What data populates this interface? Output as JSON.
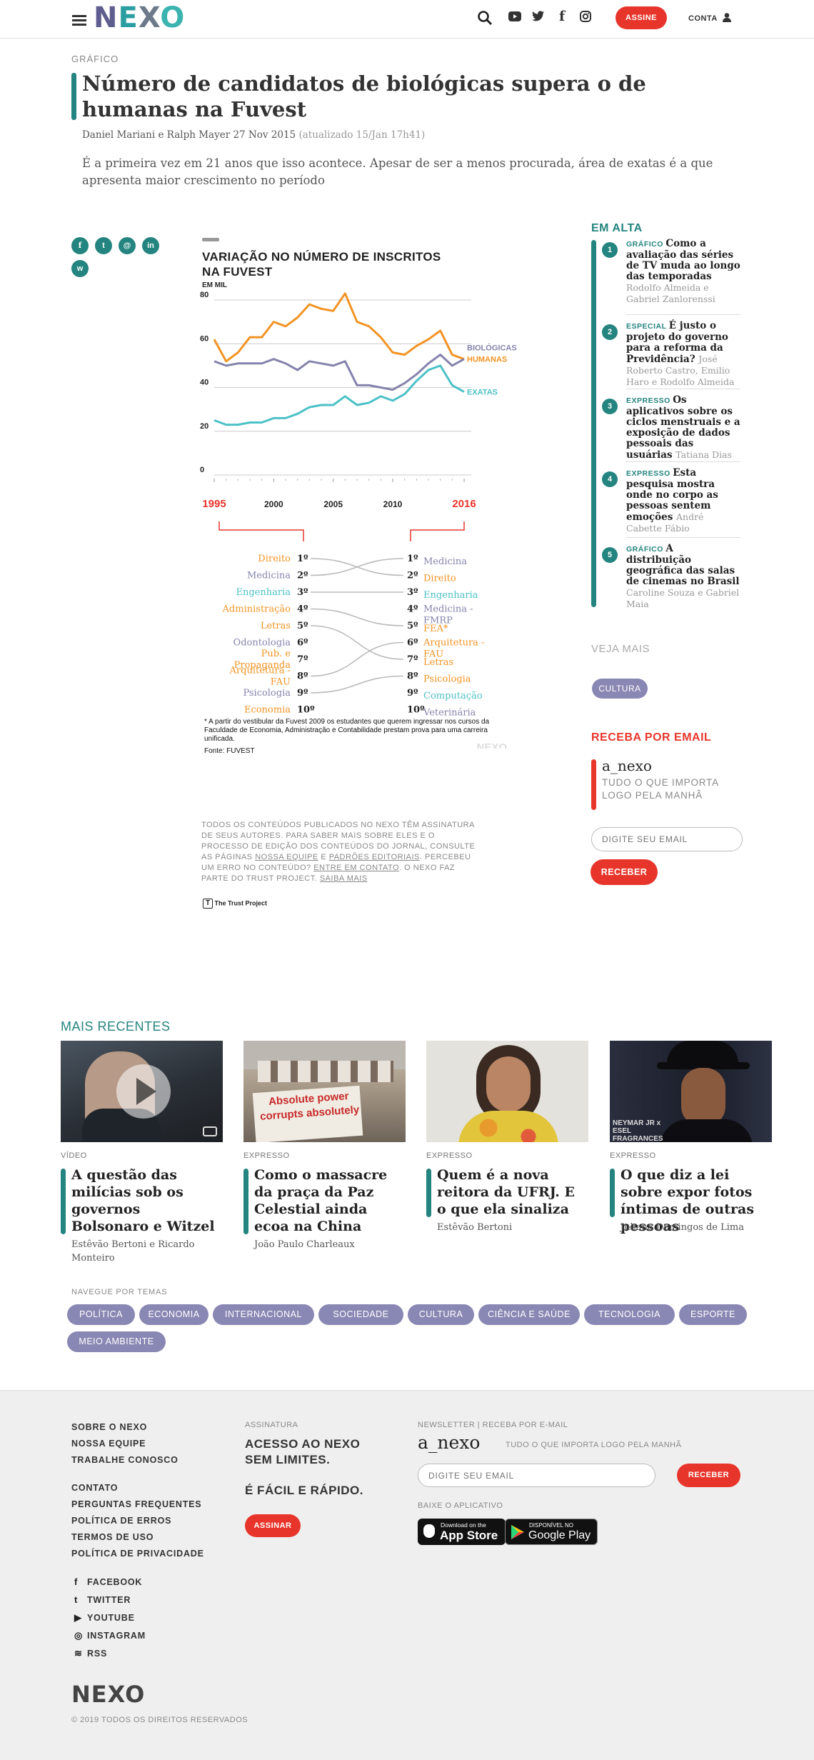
{
  "header": {
    "logo": "NEXO",
    "subscribe_label": "ASSINE",
    "account_label": "CONTA",
    "icons": [
      "menu-icon",
      "search-icon",
      "youtube-icon",
      "twitter-icon",
      "facebook-icon",
      "instagram-icon",
      "user-icon"
    ]
  },
  "article": {
    "kicker": "GRÁFICO",
    "title": "Número de candidatos de biológicas supera o de humanas na Fuvest",
    "byline": "Daniel Mariani e Ralph Mayer 27 Nov 2015",
    "updated": "(atualizado 15/Jan 17h41)",
    "lead": "É a primeira vez em 21 anos que isso acontece. Apesar de ser a menos procurada, área de exatas é a que apresenta maior crescimento no período",
    "share": [
      "f",
      "t",
      "@",
      "in",
      "w"
    ]
  },
  "chart_data": {
    "type": "line",
    "title": "VARIAÇÃO NO NÚMERO DE INSCRITOS NA FUVEST",
    "ylabel": "EM MIL",
    "ylim": [
      0,
      80
    ],
    "yticks": [
      0,
      20,
      40,
      60,
      80
    ],
    "x": [
      1995,
      1996,
      1997,
      1998,
      1999,
      2000,
      2001,
      2002,
      2003,
      2004,
      2005,
      2006,
      2007,
      2008,
      2009,
      2010,
      2011,
      2012,
      2013,
      2014,
      2015,
      2016
    ],
    "xticks": [
      "1995",
      "2000",
      "2005",
      "2010",
      "2016"
    ],
    "series": [
      {
        "name": "HUMANAS",
        "color": "#f39323",
        "values": [
          62,
          52,
          56,
          63,
          63,
          70,
          68,
          72,
          78,
          76,
          75,
          83,
          70,
          68,
          63,
          56,
          55,
          59,
          62,
          66,
          55,
          53
        ]
      },
      {
        "name": "BIOLÓGICAS",
        "color": "#8583ad",
        "values": [
          52,
          50,
          51,
          51,
          51,
          53,
          51,
          48,
          52,
          51,
          50,
          52,
          41,
          41,
          40,
          39,
          42,
          46,
          51,
          55,
          50,
          53
        ]
      },
      {
        "name": "EXATAS",
        "color": "#4cc1c6",
        "values": [
          25,
          23,
          23,
          24,
          24,
          26,
          26,
          28,
          31,
          32,
          32,
          36,
          32,
          33,
          36,
          34,
          37,
          43,
          48,
          50,
          41,
          38
        ]
      }
    ],
    "ranking": {
      "year_left": "1995",
      "year_right": "2016",
      "positions": [
        "1º",
        "2º",
        "3º",
        "4º",
        "5º",
        "6º",
        "7º",
        "8º",
        "9º",
        "10º"
      ],
      "left": [
        {
          "label": "Direito",
          "color": "#f39323"
        },
        {
          "label": "Medicina",
          "color": "#8583ad"
        },
        {
          "label": "Engenharia",
          "color": "#4cc1c6"
        },
        {
          "label": "Administração",
          "color": "#f39323"
        },
        {
          "label": "Letras",
          "color": "#f39323"
        },
        {
          "label": "Odontologia",
          "color": "#8583ad"
        },
        {
          "label": "Pub. e Propaganda",
          "color": "#f39323"
        },
        {
          "label": "Arquitetura - FAU",
          "color": "#f39323"
        },
        {
          "label": "Psicologia",
          "color": "#8583ad"
        },
        {
          "label": "Economia",
          "color": "#f39323"
        }
      ],
      "right": [
        {
          "label": "Medicina",
          "color": "#8583ad"
        },
        {
          "label": "Direito",
          "color": "#f39323"
        },
        {
          "label": "Engenharia",
          "color": "#4cc1c6"
        },
        {
          "label": "Medicina - FMRP",
          "color": "#8583ad"
        },
        {
          "label": "FEA*",
          "color": "#f39323"
        },
        {
          "label": "Arquitetura - FAU",
          "color": "#f39323"
        },
        {
          "label": "Letras",
          "color": "#f39323"
        },
        {
          "label": "Psicologia",
          "color": "#f39323"
        },
        {
          "label": "Computação",
          "color": "#4cc1c6"
        },
        {
          "label": "Veterinária",
          "color": "#8583ad"
        }
      ],
      "links": [
        [
          1,
          2
        ],
        [
          2,
          1
        ],
        [
          3,
          3
        ],
        [
          4,
          5
        ],
        [
          5,
          7
        ],
        [
          8,
          6
        ],
        [
          9,
          8
        ]
      ]
    },
    "footnote": "* A partir do vestibular da Fuvest 2009 os estudantes que querem ingressar nos cursos da Faculdade de Economia, Administração e Contabilidade prestam prova para uma carreira unificada.",
    "source": "Fonte: FUVEST",
    "watermark": "NEXO"
  },
  "disclaimer": {
    "p1": "TODOS OS CONTEÚDOS PUBLICADOS NO NEXO TÊM ASSINATURA DE SEUS AUTORES. PARA SABER MAIS SOBRE ELES E O PROCESSO DE EDIÇÃO DOS CONTEÚDOS DO JORNAL, CONSULTE AS PÁGINAS",
    "link1": "NOSSA EQUIPE",
    "and": "E",
    "link2": "PADRÕES EDITORIAIS",
    "p2": ". PERCEBEU UM ERRO NO CONTEÚDO?",
    "link3": "ENTRE EM CONTATO",
    "p3": ". O NEXO FAZ PARTE DO TRUST PROJECT.",
    "link4": "SAIBA MAIS",
    "trust": "The Trust Project"
  },
  "sidebar": {
    "trending_title": "EM ALTA",
    "trending": [
      {
        "n": "1",
        "cat": "GRÁFICO",
        "title": "Como a avaliação das séries de TV muda ao longo das temporadas",
        "authors": "Rodolfo Almeida e Gabriel Zanlorenssi"
      },
      {
        "n": "2",
        "cat": "ESPECIAL",
        "title": "É justo o projeto do governo para a reforma da Previdência?",
        "authors": "José Roberto Castro, Emilio Haro e Rodolfo Almeida"
      },
      {
        "n": "3",
        "cat": "EXPRESSO",
        "title": "Os aplicativos sobre os ciclos menstruais e a exposição de dados pessoais das usuárias",
        "authors": "Tatiana Dias"
      },
      {
        "n": "4",
        "cat": "EXPRESSO",
        "title": "Esta pesquisa mostra onde no corpo as pessoas sentem emoções",
        "authors": "André Cabette Fábio"
      },
      {
        "n": "5",
        "cat": "GRÁFICO",
        "title": "A distribuição geográfica das salas de cinemas no Brasil",
        "authors": "Caroline Souza e Gabriel Maia"
      }
    ],
    "see_more": "VEJA MAIS",
    "tag": "CULTURA",
    "newsletter_title": "RECEBA POR EMAIL",
    "nl_name": "a_nexo",
    "nl_desc": "TUDO O QUE IMPORTA LOGO PELA MANHÃ",
    "email_placeholder": "DIGITE SEU EMAIL",
    "receive": "RECEBER"
  },
  "recent": {
    "title": "MAIS RECENTES",
    "cards": [
      {
        "cat": "VÍDEO",
        "title": "A questão das milícias sob os governos Bolsonaro e Witzel",
        "authors": "Estêvão Bertoni e Ricardo Monteiro"
      },
      {
        "cat": "EXPRESSO",
        "title": "Como o massacre da praça da Paz Celestial ainda ecoa na China",
        "authors": "João Paulo Charleaux"
      },
      {
        "cat": "EXPRESSO",
        "title": "Quem é a nova reitora da UFRJ. E o que ela sinaliza",
        "authors": "Estêvão Bertoni"
      },
      {
        "cat": "EXPRESSO",
        "title": "O que diz a lei sobre expor fotos íntimas de outras pessoas",
        "authors": "Juliana Domingos de Lima"
      }
    ],
    "img2_text": "Absolute power corrupts absolutely",
    "img4_text": "NEYMAR JR x ESEL FRAGRANCES"
  },
  "themes": {
    "title": "NAVEGUE POR TEMAS",
    "tags": [
      "POLÍTICA",
      "ECONOMIA",
      "INTERNACIONAL",
      "SOCIEDADE",
      "CULTURA",
      "CIÊNCIA E SAÚDE",
      "TECNOLOGIA",
      "ESPORTE",
      "MEIO AMBIENTE"
    ]
  },
  "footer": {
    "links1": [
      "SOBRE O NEXO",
      "NOSSA EQUIPE",
      "TRABALHE CONOSCO"
    ],
    "links2": [
      "CONTATO",
      "PERGUNTAS FREQUENTES",
      "POLÍTICA DE ERROS",
      "TERMOS DE USO",
      "POLÍTICA DE PRIVACIDADE"
    ],
    "social": [
      "FACEBOOK",
      "TWITTER",
      "YOUTUBE",
      "INSTAGRAM",
      "RSS"
    ],
    "sub_kicker": "ASSINATURA",
    "sub_line1": "ACESSO AO NEXO SEM LIMITES.",
    "sub_line2": "É FÁCIL E RÁPIDO.",
    "sub_btn": "ASSINAR",
    "nl_kicker": "NEWSLETTER | RECEBA POR E-MAIL",
    "nl_name": "a_nexo",
    "nl_desc": "TUDO O QUE IMPORTA LOGO PELA MANHÃ",
    "email_placeholder": "DIGITE SEU EMAIL",
    "receive": "RECEBER",
    "app_kicker": "BAIXE O APLICATIVO",
    "appstore_small": "Download on the",
    "appstore": "App Store",
    "play_small": "DISPONÍVEL NO",
    "play": "Google Play",
    "logo": "NEXO",
    "copyright": "© 2019 TODOS OS DIREITOS RESERVADOS"
  }
}
